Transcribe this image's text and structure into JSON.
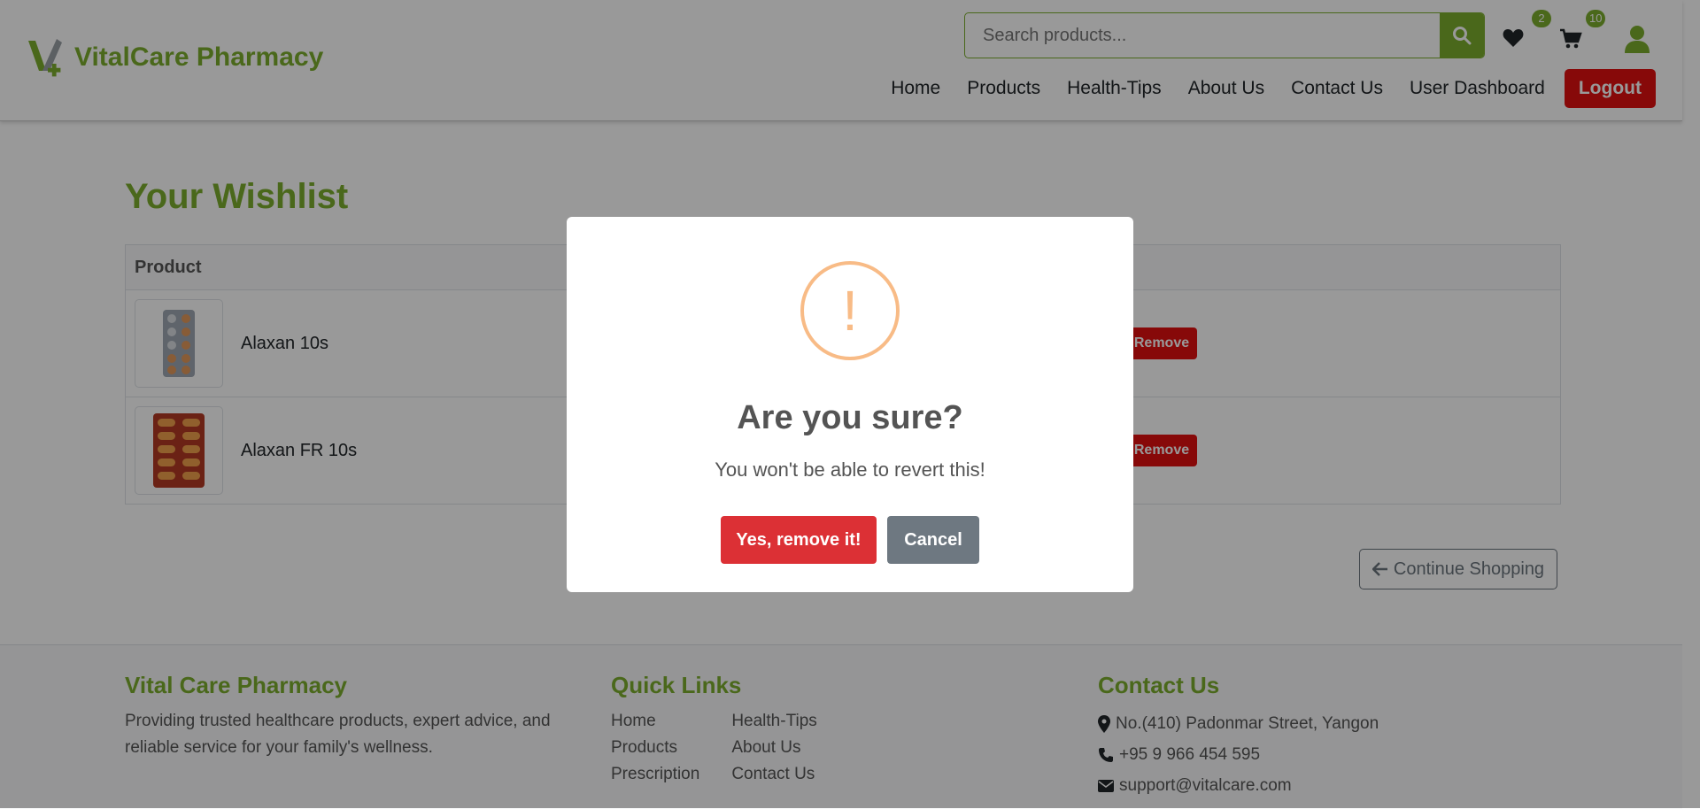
{
  "brand": {
    "name": "VitalCare Pharmacy",
    "accent": "#7cae2e",
    "danger": "#e11010"
  },
  "search": {
    "placeholder": "Search products..."
  },
  "header_icons": {
    "wishlist_count": "2",
    "cart_count": "10"
  },
  "nav": {
    "items": [
      "Home",
      "Products",
      "Health-Tips",
      "About Us",
      "Contact Us",
      "User Dashboard"
    ],
    "logout": "Logout"
  },
  "page": {
    "title": "Your Wishlist"
  },
  "table": {
    "header": "Product",
    "rows": [
      {
        "name": "Alaxan 10s",
        "action": "Remove"
      },
      {
        "name": "Alaxan FR 10s",
        "action": "Remove"
      }
    ]
  },
  "continue_label": "Continue Shopping",
  "footer": {
    "about_title": "Vital Care Pharmacy",
    "about_text": "Providing trusted healthcare products, expert advice, and reliable service for your family's wellness.",
    "links_title": "Quick Links",
    "links_col1": [
      "Home",
      "Products",
      "Prescription"
    ],
    "links_col2": [
      "Health-Tips",
      "About Us",
      "Contact Us"
    ],
    "contact_title": "Contact Us",
    "address": "No.(410) Padonmar Street, Yangon",
    "phone": "+95 9 966 454 595",
    "email": "support@vitalcare.com"
  },
  "modal": {
    "icon": "!",
    "title": "Are you sure?",
    "text": "You won't be able to revert this!",
    "confirm": "Yes, remove it!",
    "cancel": "Cancel"
  }
}
